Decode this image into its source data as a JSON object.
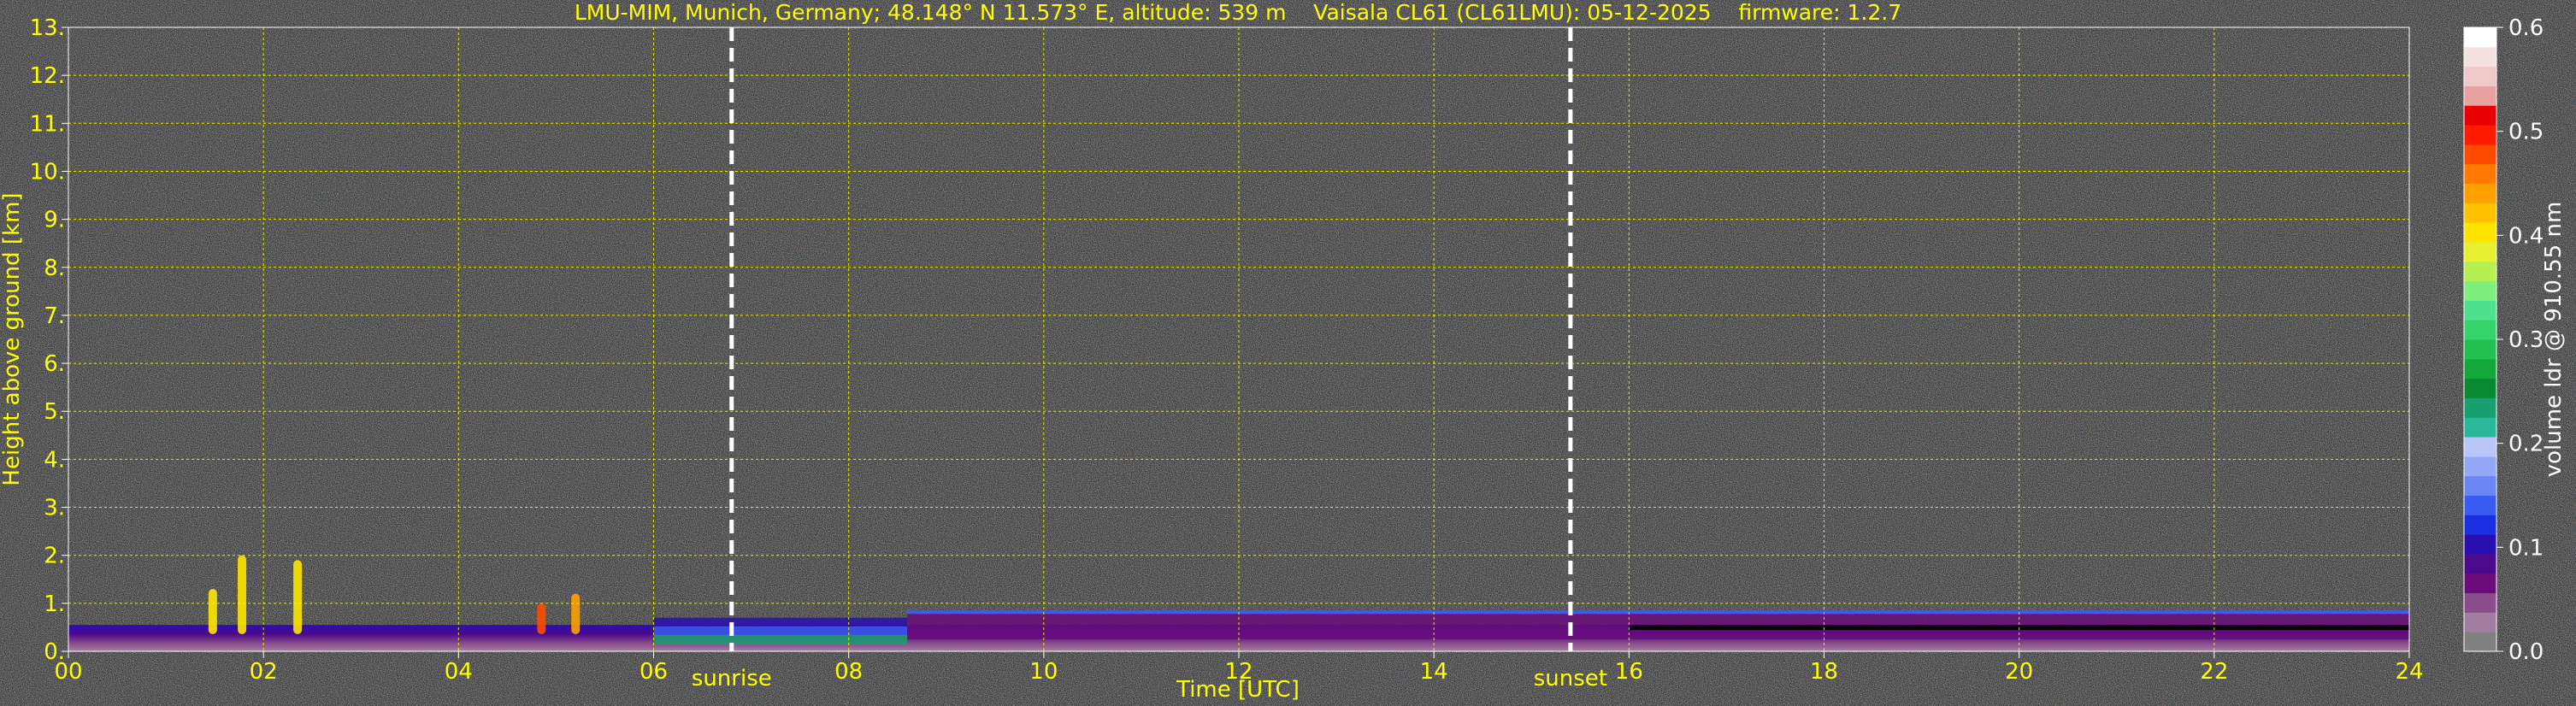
{
  "chart_data": {
    "type": "heatmap",
    "title": "LMU-MIM, Munich, Germany; 48.148° N 11.573° E, altitude: 539 m    Vaisala CL61 (CL61LMU): 05-12-2025    firmware: 1.2.7",
    "xlabel": "Time [UTC]",
    "ylabel": "Height above ground [km]",
    "xlim": [
      0,
      24
    ],
    "ylim": [
      0,
      13
    ],
    "x_ticks": [
      "00",
      "02",
      "04",
      "06",
      "08",
      "10",
      "12",
      "14",
      "16",
      "18",
      "20",
      "22",
      "24"
    ],
    "y_ticks": [
      "0.",
      "1.",
      "2.",
      "3.",
      "4.",
      "5.",
      "6.",
      "7.",
      "8.",
      "9.",
      "10.",
      "11.",
      "12.",
      "13."
    ],
    "grid": true,
    "markers": [
      {
        "label": "sunrise",
        "time": 6.8
      },
      {
        "label": "sunset",
        "time": 15.4
      }
    ],
    "colorbar": {
      "label": "volume ldr @ 910.55 nm",
      "range": [
        0.0,
        0.6
      ],
      "ticks": [
        "0.0",
        "0.1",
        "0.2",
        "0.3",
        "0.4",
        "0.5",
        "0.6"
      ],
      "colors": [
        "#808080",
        "#a27fa2",
        "#8a4c8a",
        "#6a0d7a",
        "#4b0b8c",
        "#2a0fb0",
        "#1a30e0",
        "#3a5cf0",
        "#6a86f4",
        "#92a8f6",
        "#b8c6f8",
        "#2ab89a",
        "#18a070",
        "#0a8a30",
        "#14a83a",
        "#22c050",
        "#34d46a",
        "#4ee08a",
        "#7cf07a",
        "#b6f050",
        "#e6f030",
        "#ffe400",
        "#ffc200",
        "#ffa000",
        "#ff7a00",
        "#ff4a00",
        "#ff1a00",
        "#e80000",
        "#e8a0a0",
        "#f0c8c8",
        "#f4e0e0",
        "#ffffff"
      ]
    },
    "features": [
      {
        "kind": "layer",
        "from_h": 6,
        "to_h": 8.6,
        "top_km": 0.7,
        "colors": [
          "#2a0fb0",
          "#3a5cf0",
          "#18a070"
        ]
      },
      {
        "kind": "column",
        "time_h": 1.48,
        "top_km": 1.3,
        "color": "#ffe400"
      },
      {
        "kind": "column",
        "time_h": 1.78,
        "top_km": 2.0,
        "color": "#ffe400"
      },
      {
        "kind": "column",
        "time_h": 2.35,
        "top_km": 1.9,
        "color": "#ffe400"
      },
      {
        "kind": "column",
        "time_h": 4.85,
        "top_km": 1.0,
        "color": "#ff4a00"
      },
      {
        "kind": "column",
        "time_h": 5.2,
        "top_km": 1.2,
        "color": "#ffa000"
      },
      {
        "kind": "boundary_layer",
        "from_h": 8.6,
        "to_h": 24,
        "top_km": 0.8,
        "color": "#6a0d7a"
      }
    ]
  }
}
